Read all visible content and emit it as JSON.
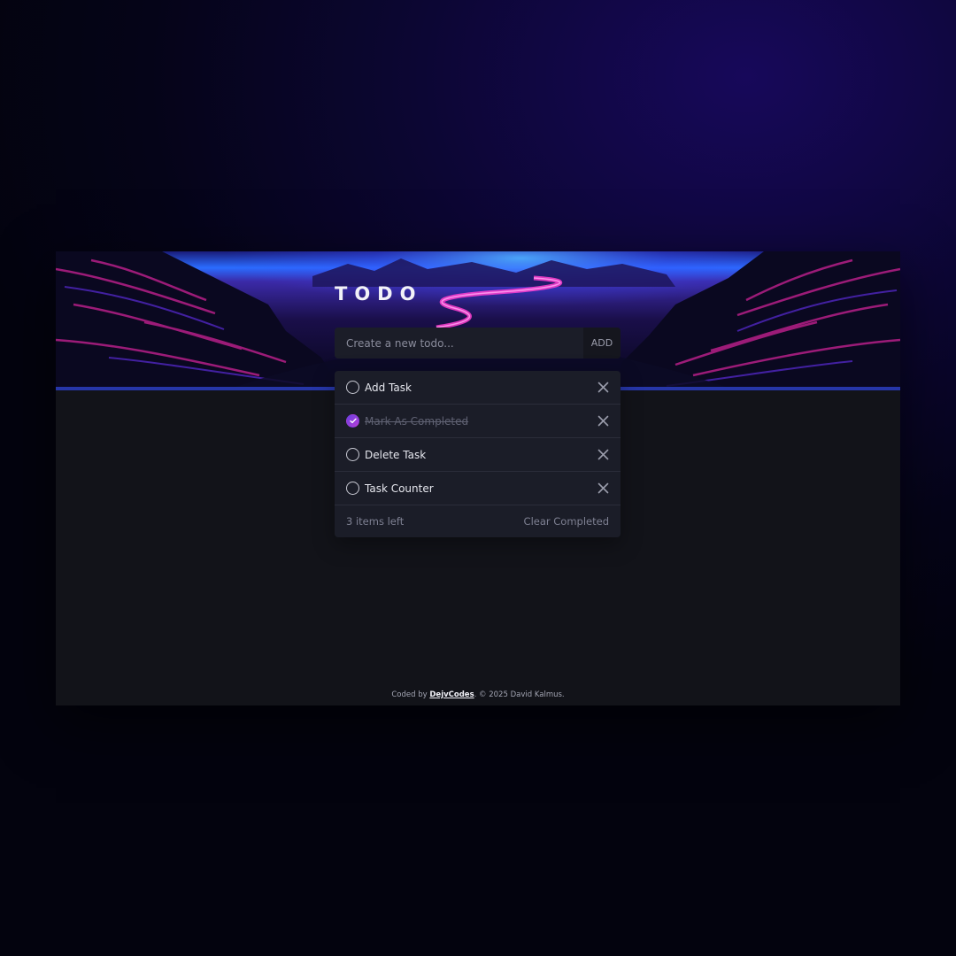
{
  "app": {
    "title": "TODO"
  },
  "new_todo": {
    "placeholder": "Create a new todo...",
    "add_label": "ADD"
  },
  "todos": [
    {
      "label": "Add Task",
      "completed": false
    },
    {
      "label": "Mark As Completed",
      "completed": true
    },
    {
      "label": "Delete Task",
      "completed": false
    },
    {
      "label": "Task Counter",
      "completed": false
    }
  ],
  "footer": {
    "items_left": "3 items left",
    "clear_label": "Clear Completed"
  },
  "credit": {
    "prefix": "Coded by",
    "author_link": "DejvCodes",
    "suffix": ". © 2025 David Kalmus."
  },
  "colors": {
    "accent_start": "#6a3fe0",
    "accent_end": "#b63fd8",
    "panel": "#1b1d28",
    "page": "#121319"
  },
  "icons": {
    "delete": "close-icon",
    "check": "check-icon"
  }
}
